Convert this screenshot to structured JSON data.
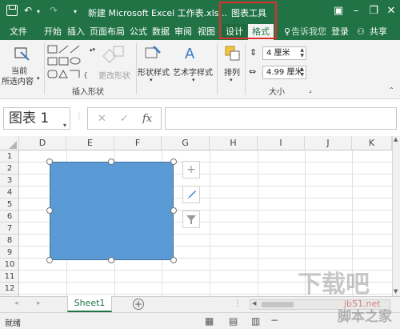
{
  "titlebar": {
    "document_title": "新建 Microsoft Excel 工作表.xls...",
    "context_label": "图表工具",
    "undo_symbol": "↶",
    "redo_symbol": "↷"
  },
  "tabs": [
    "文件",
    "开始",
    "插入",
    "页面布局",
    "公式",
    "数据",
    "审阅",
    "视图",
    "设计",
    "格式"
  ],
  "tell_me": "告诉我您",
  "signin": "登录",
  "share": "共享",
  "ribbon": {
    "current_selection": [
      "当前",
      "所选内容"
    ],
    "insert_shapes_label": "插入形状",
    "change_shape": "更改形状",
    "shape_styles": "形状样式",
    "wordart_styles": "艺术字样式",
    "arrange": "排列",
    "height": "4 厘米",
    "width": "4.99 厘米",
    "size_label": "大小"
  },
  "formula_bar": {
    "name_box": "图表 1",
    "cancel": "✕",
    "enter": "✓",
    "fx": "fx"
  },
  "grid": {
    "columns": [
      "D",
      "E",
      "F",
      "G",
      "H",
      "I",
      "J",
      "K"
    ],
    "rows": [
      "1",
      "2",
      "3",
      "4",
      "5",
      "6",
      "7",
      "8",
      "9",
      "10",
      "11",
      "12"
    ]
  },
  "chart_buttons": [
    "+",
    "✎",
    "▼"
  ],
  "sheet_tab": "Sheet1",
  "status": "就绪",
  "watermark": [
    "下载吧",
    "jb51.net",
    "脚本之家"
  ],
  "colors": {
    "excel_green": "#217346",
    "shape_fill": "#5b9bd5",
    "highlight_box": "#e0302a"
  }
}
